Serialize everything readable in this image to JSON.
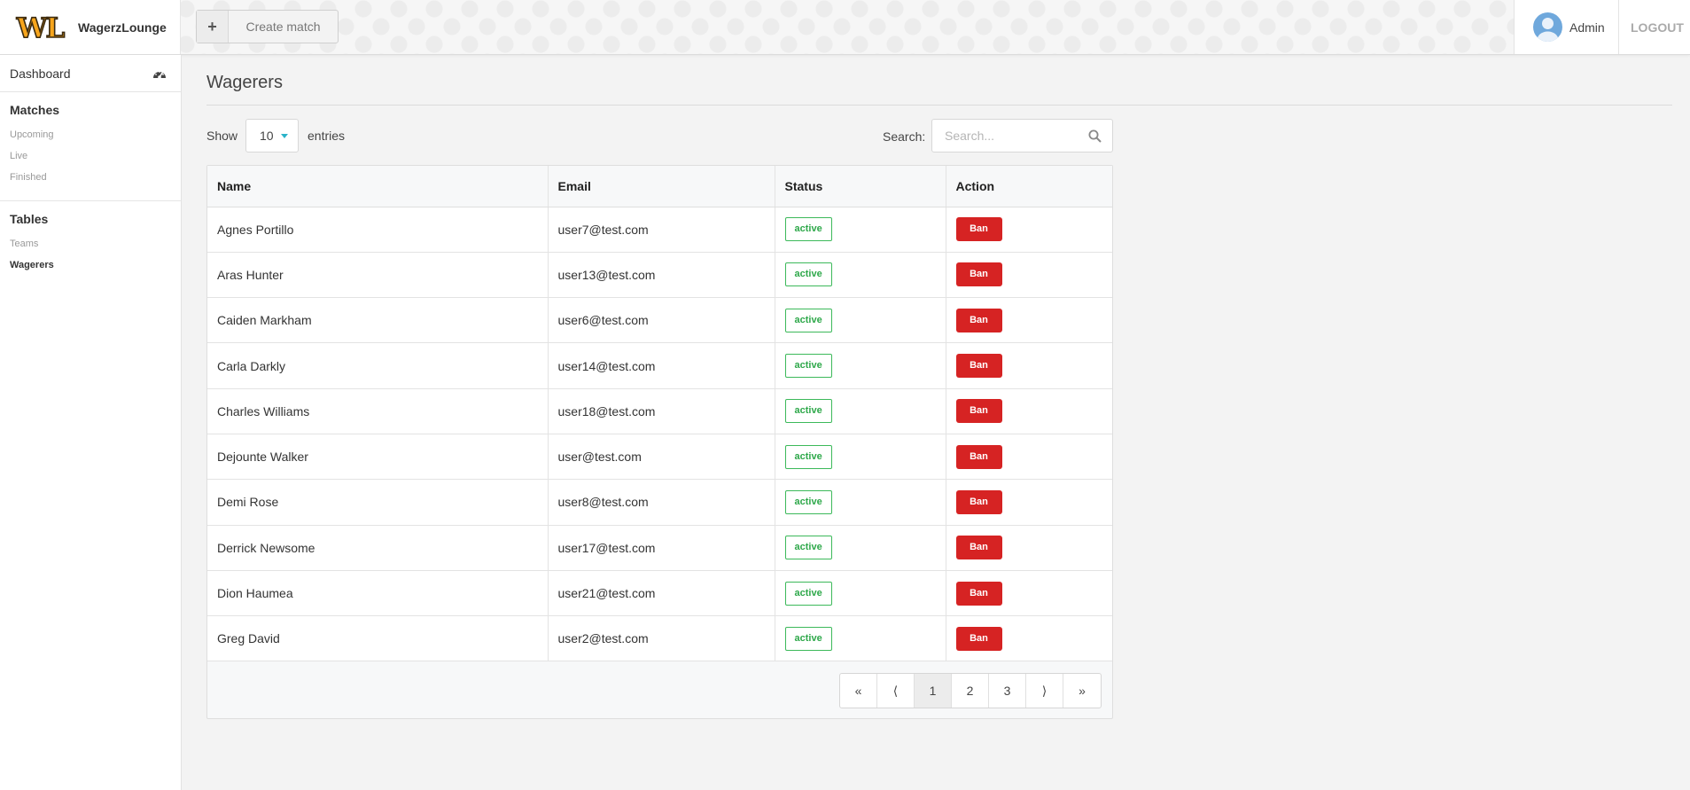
{
  "brand": {
    "name": "WagerzLounge",
    "logo_text": "WL"
  },
  "toolbar": {
    "create_label": "Create match",
    "plus_glyph": "+"
  },
  "user": {
    "name": "Admin",
    "logout_label": "LOGOUT"
  },
  "sidebar": {
    "dashboard_label": "Dashboard",
    "matches": {
      "heading": "Matches",
      "items": [
        "Upcoming",
        "Live",
        "Finished"
      ]
    },
    "tables": {
      "heading": "Tables",
      "items": [
        "Teams",
        "Wagerers"
      ],
      "active": "Wagerers"
    }
  },
  "page": {
    "title": "Wagerers"
  },
  "controls": {
    "show_label": "Show",
    "page_size": "10",
    "entries_label": "entries",
    "search_label": "Search:",
    "search_placeholder": "Search...",
    "search_value": ""
  },
  "table": {
    "columns": [
      "Name",
      "Email",
      "Status",
      "Action"
    ],
    "rows": [
      {
        "name": "Agnes Portillo",
        "email": "user7@test.com",
        "status": "active",
        "action": "Ban"
      },
      {
        "name": "Aras Hunter",
        "email": "user13@test.com",
        "status": "active",
        "action": "Ban"
      },
      {
        "name": "Caiden Markham",
        "email": "user6@test.com",
        "status": "active",
        "action": "Ban"
      },
      {
        "name": "Carla Darkly",
        "email": "user14@test.com",
        "status": "active",
        "action": "Ban"
      },
      {
        "name": "Charles Williams",
        "email": "user18@test.com",
        "status": "active",
        "action": "Ban"
      },
      {
        "name": "Dejounte Walker",
        "email": "user@test.com",
        "status": "active",
        "action": "Ban"
      },
      {
        "name": "Demi Rose",
        "email": "user8@test.com",
        "status": "active",
        "action": "Ban"
      },
      {
        "name": "Derrick Newsome",
        "email": "user17@test.com",
        "status": "active",
        "action": "Ban"
      },
      {
        "name": "Dion Haumea",
        "email": "user21@test.com",
        "status": "active",
        "action": "Ban"
      },
      {
        "name": "Greg David",
        "email": "user2@test.com",
        "status": "active",
        "action": "Ban"
      }
    ]
  },
  "pagination": {
    "first": "«",
    "prev": "⟨",
    "pages": [
      "1",
      "2",
      "3"
    ],
    "current": "1",
    "next": "⟩",
    "last": "»"
  },
  "colors": {
    "ban": "#d62323",
    "active_badge": "#3cb95a",
    "logo_fill": "#f7a51c",
    "caret": "#2ab3c9"
  },
  "icons": {
    "dashboard": "gauge-icon",
    "search": "search-icon",
    "avatar": "user-avatar-icon",
    "add": "plus-icon"
  }
}
